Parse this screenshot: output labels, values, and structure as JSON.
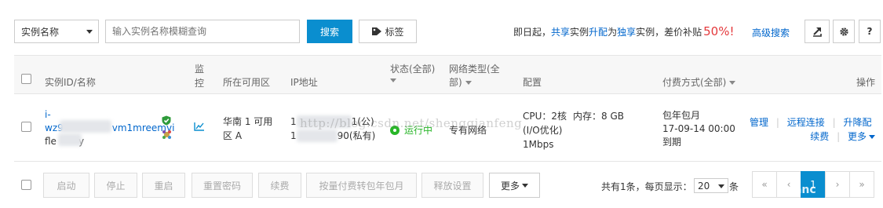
{
  "toolbar": {
    "select_value": "实例名称",
    "search_placeholder": "输入实例名称模糊查询",
    "search_button": "搜索",
    "tag_button": "标签",
    "promo_prefix": "即日起，",
    "promo_share": "共享",
    "promo_mid1": "实例",
    "promo_upgrade": "升配",
    "promo_mid2": "为",
    "promo_exclusive": "独享",
    "promo_mid3": "实例，差价补贴",
    "promo_percent": "50%!",
    "advanced_search": "高级搜索"
  },
  "table": {
    "headers": {
      "instance": "实例ID/名称",
      "monitor_line1": "监",
      "monitor_line2": "控",
      "zone": "所在可用区",
      "ip": "IP地址",
      "status": "状态(全部)",
      "network_line1": "网络类型(全",
      "network_line2": "部)",
      "config": "配置",
      "billing": "付费方式(全部)",
      "actions": "操作"
    },
    "row": {
      "id_line1": "i-",
      "id_line2": "wz9",
      "id_line2_tail": "vm1mreemvi",
      "name": "fle",
      "name_tail": "y",
      "zone": "华南 1 可用区 A",
      "ip_public_head": "1",
      "ip_public_tail": "1(公)",
      "ip_private_head": "1",
      "ip_private_tail": "90(私有)",
      "status": "运行中",
      "network": "专有网络",
      "config_cpu": "CPU：2核",
      "config_mem": "内存：8 GB",
      "config_io": "(I/O优化)",
      "config_bw": "1Mbps",
      "billing_type": "包年包月",
      "billing_date": "17-09-14 00:00",
      "billing_expire": "到期",
      "action_manage": "管理",
      "action_remote": "远程连接",
      "action_upgrade": "升降配",
      "action_renew": "续费",
      "action_more": "更多"
    }
  },
  "footer": {
    "buttons": [
      "启动",
      "停止",
      "重启",
      "重置密码",
      "续费",
      "按量付费转包年包月",
      "释放设置"
    ],
    "more": "更多",
    "total": "共有1条，",
    "per_page_label": "每页显示：",
    "per_page_value": "20",
    "per_page_unit": "条",
    "current_page": "1"
  },
  "watermark": "http://blog.csdn.net/shengqianfeng",
  "watermark_corner": "uanc",
  "colors": {
    "primary": "#0a8ecf",
    "link": "#0066cc",
    "promo_red": "#e4393c",
    "running_green": "#28b628",
    "header_bg": "#f7f7f7"
  }
}
